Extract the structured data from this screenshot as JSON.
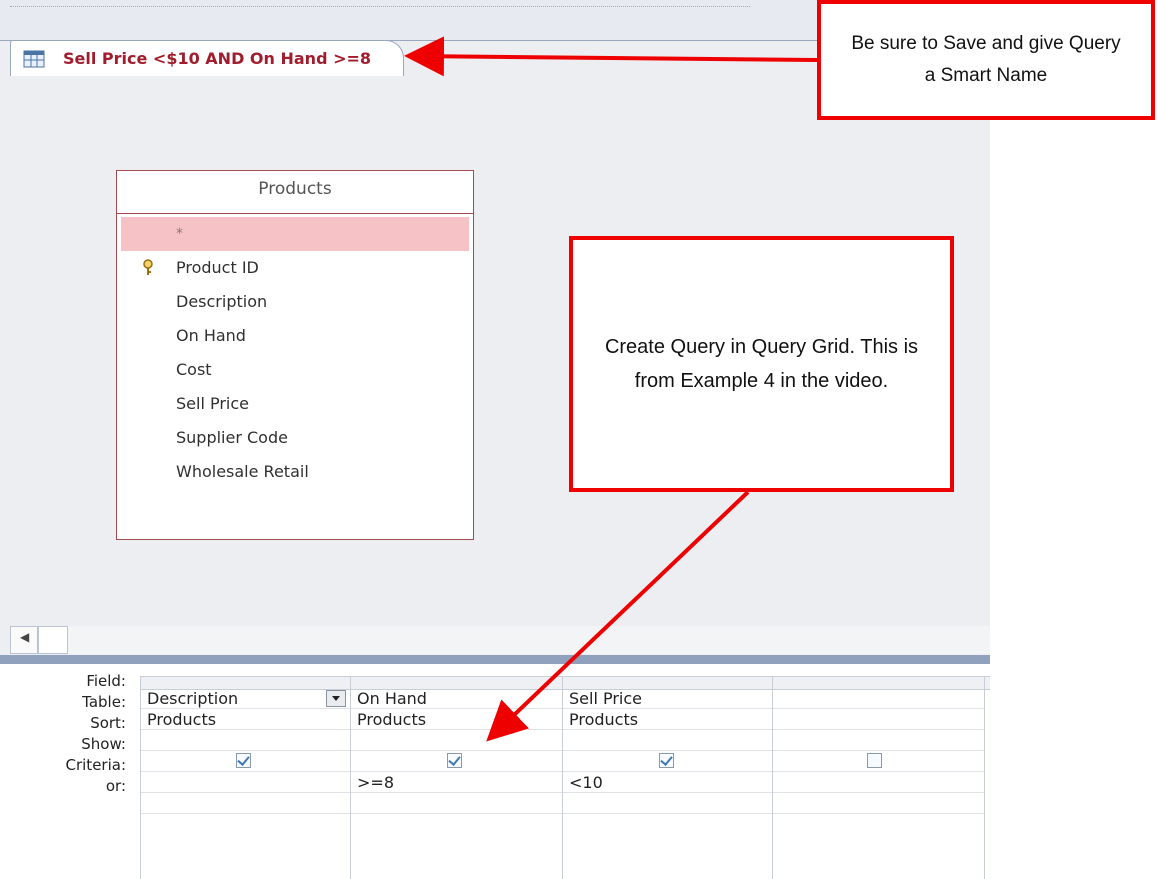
{
  "tab": {
    "title": "Sell Price <$10 AND On Hand >=8",
    "icon": "query-icon"
  },
  "table": {
    "name": "Products",
    "star": "*",
    "fields": [
      "Product ID",
      "Description",
      "On Hand",
      "Cost",
      "Sell Price",
      "Supplier Code",
      "Wholesale Retail"
    ],
    "key_field": "Product ID",
    "key_icon": "primary-key-icon"
  },
  "grid": {
    "row_labels": [
      "Field:",
      "Table:",
      "Sort:",
      "Show:",
      "Criteria:",
      "or:"
    ],
    "columns": [
      {
        "field": "Description",
        "table": "Products",
        "sort": "",
        "show": true,
        "criteria": "",
        "or": ""
      },
      {
        "field": "On Hand",
        "table": "Products",
        "sort": "",
        "show": true,
        "criteria": ">=8",
        "or": ""
      },
      {
        "field": "Sell Price",
        "table": "Products",
        "sort": "",
        "show": true,
        "criteria": "<10",
        "or": ""
      },
      {
        "field": "",
        "table": "",
        "sort": "",
        "show": false,
        "criteria": "",
        "or": ""
      }
    ]
  },
  "scroll": {
    "left_arrow_icon": "scroll-left-icon"
  },
  "callouts": {
    "top": "Be sure to Save and give Query a Smart Name",
    "middle": "Create Query in Query Grid. This is from Example 4 in the video."
  },
  "colors": {
    "tab_text": "#a11d2d",
    "selected_row": "#f6c2c6",
    "callout_border": "#ee0000",
    "arrow": "#ee0000"
  }
}
